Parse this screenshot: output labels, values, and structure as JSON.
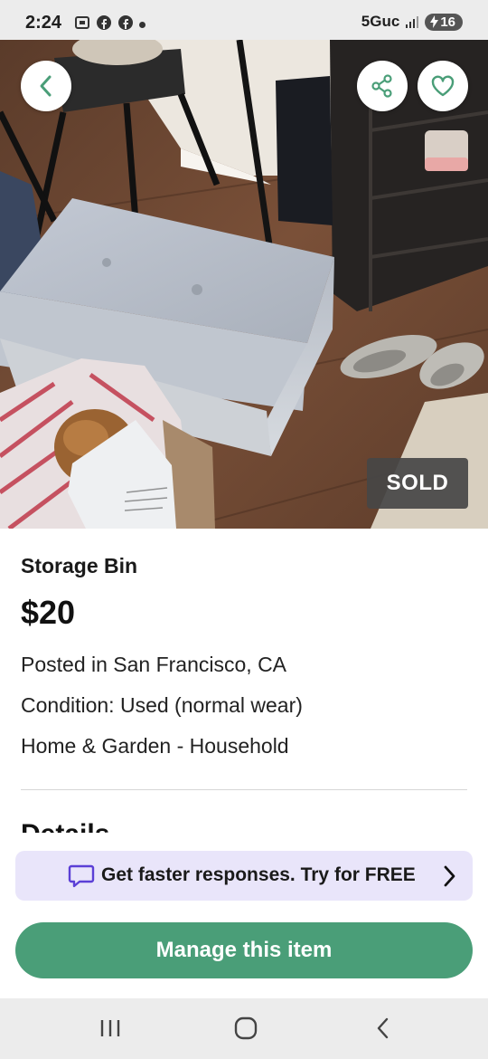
{
  "status_bar": {
    "time": "2:24",
    "network": "5Guc",
    "battery": "16"
  },
  "photo": {
    "sold_label": "SOLD"
  },
  "listing": {
    "title": "Storage Bin",
    "price": "$20",
    "location": "Posted in San Francisco, CA",
    "condition": "Condition: Used (normal wear)",
    "category": "Home & Garden - Household",
    "details_heading": "Details"
  },
  "promo": {
    "text": "Get faster responses. Try for FREE",
    "icon": "chat-bubble-icon"
  },
  "actions": {
    "manage_label": "Manage this item"
  },
  "icons": {
    "back": "chevron-left-icon",
    "share": "share-icon",
    "favorite": "heart-icon"
  },
  "colors": {
    "accent_green": "#4a9e78",
    "promo_bg": "#e9e5fa",
    "promo_icon": "#5b3fd6",
    "back_chevron": "#4a9e78"
  }
}
